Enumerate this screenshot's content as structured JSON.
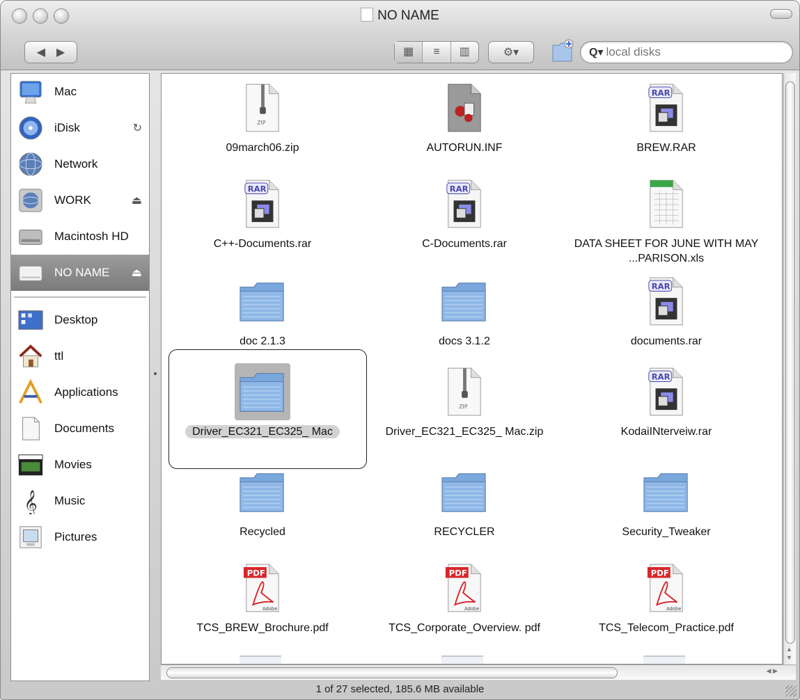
{
  "window": {
    "title": "NO NAME",
    "status": "1 of 27 selected, 185.6 MB available"
  },
  "toolbar": {
    "back_label": "◀",
    "forward_label": "▶",
    "views": [
      {
        "name": "icon-view",
        "glyph": "▦"
      },
      {
        "name": "list-view",
        "glyph": "≡"
      },
      {
        "name": "column-view",
        "glyph": "▥"
      }
    ],
    "action_label": "⚙▾",
    "search_placeholder": "local disks"
  },
  "sidebar": {
    "devices": [
      {
        "label": "Mac",
        "icon": "imac-icon"
      },
      {
        "label": "iDisk",
        "icon": "idisk-icon",
        "right": "↻"
      },
      {
        "label": "Network",
        "icon": "network-icon"
      },
      {
        "label": "WORK",
        "icon": "server-icon",
        "right": "⏏"
      },
      {
        "label": "Macintosh HD",
        "icon": "hard-drive-icon"
      },
      {
        "label": "NO NAME",
        "icon": "removable-drive-icon",
        "right": "⏏",
        "selected": true
      }
    ],
    "places": [
      {
        "label": "Desktop",
        "icon": "desktop-icon"
      },
      {
        "label": "ttl",
        "icon": "home-icon"
      },
      {
        "label": "Applications",
        "icon": "applications-icon"
      },
      {
        "label": "Documents",
        "icon": "documents-icon"
      },
      {
        "label": "Movies",
        "icon": "movies-icon"
      },
      {
        "label": "Music",
        "icon": "music-icon"
      },
      {
        "label": "Pictures",
        "icon": "pictures-icon"
      }
    ]
  },
  "files": [
    {
      "name": "09march06.zip",
      "type": "zip"
    },
    {
      "name": "AUTORUN.INF",
      "type": "inf"
    },
    {
      "name": "BREW.RAR",
      "type": "rar"
    },
    {
      "name": "C++-Documents.rar",
      "type": "rar"
    },
    {
      "name": "C-Documents.rar",
      "type": "rar"
    },
    {
      "name": "DATA SHEET FOR JUNE WITH MAY ...PARISON.xls",
      "type": "xls"
    },
    {
      "name": "doc 2.1.3",
      "type": "folder"
    },
    {
      "name": "docs 3.1.2",
      "type": "folder"
    },
    {
      "name": "documents.rar",
      "type": "rar"
    },
    {
      "name": "Driver_EC321_EC325_ Mac",
      "type": "folder",
      "selected": true
    },
    {
      "name": "Driver_EC321_EC325_ Mac.zip",
      "type": "zip"
    },
    {
      "name": "KodaiINterveiw.rar",
      "type": "rar"
    },
    {
      "name": "Recycled",
      "type": "folder"
    },
    {
      "name": "RECYCLER",
      "type": "folder"
    },
    {
      "name": "Security_Tweaker",
      "type": "folder"
    },
    {
      "name": "TCS_BREW_Brochure.pdf",
      "type": "pdf"
    },
    {
      "name": "TCS_Corporate_Overview. pdf",
      "type": "pdf"
    },
    {
      "name": "TCS_Telecom_Practice.pdf",
      "type": "pdf"
    }
  ],
  "colors": {
    "selection_gray": "#b5b5b5",
    "folder_blue": "#8fb8e8",
    "pdf_red": "#d8262b",
    "rar_purple": "#4a4aa8",
    "xls_green": "#3aa648"
  }
}
